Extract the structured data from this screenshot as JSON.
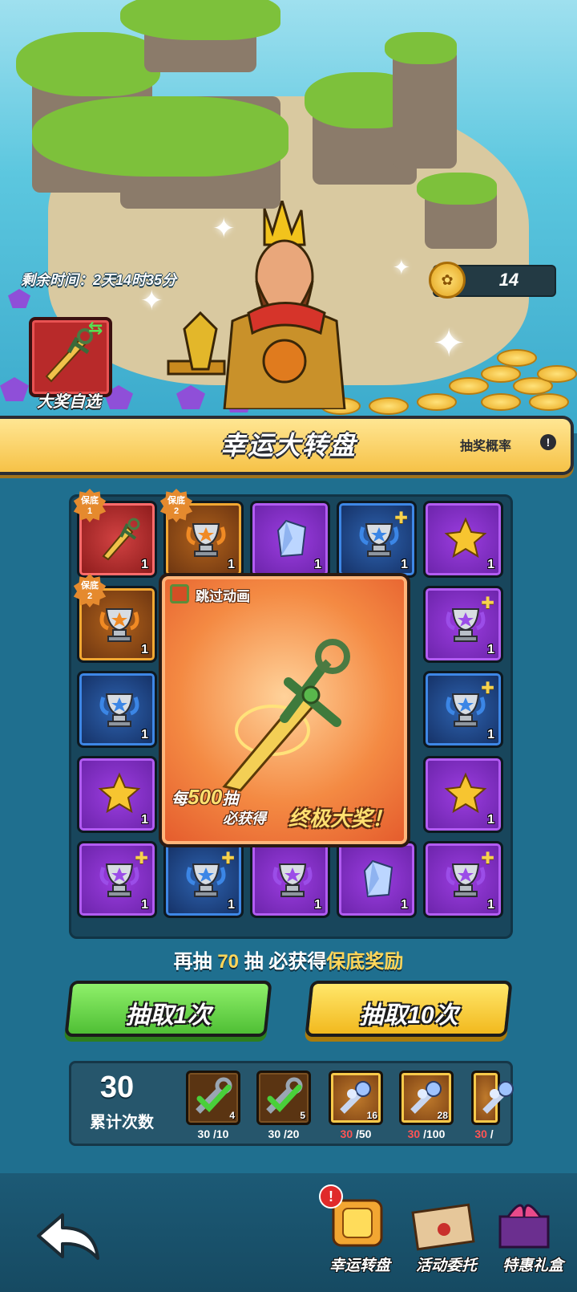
{
  "header": {
    "timer": "剩余时间：2天14时35分",
    "coins": "14",
    "grand_prize_label": "大奖自选"
  },
  "banner": {
    "title": "幸运大转盘",
    "prob_label": "抽奖概率",
    "prob_icon": "!"
  },
  "board": {
    "badge_label": "保底",
    "cells": [
      {
        "type": "sword",
        "color": "red",
        "qty": "1",
        "badge": "1"
      },
      {
        "type": "trophy-orange",
        "color": "orange",
        "qty": "1",
        "badge": "2"
      },
      {
        "type": "crystal",
        "color": "purple",
        "qty": "1"
      },
      {
        "type": "trophy-blue-plus",
        "color": "blue",
        "qty": "1"
      },
      {
        "type": "star",
        "color": "purple",
        "qty": "1"
      },
      {
        "type": "trophy-orange",
        "color": "orange",
        "qty": "1",
        "badge": "2"
      },
      {
        "type": "trophy-purple-plus",
        "color": "purple",
        "qty": "1"
      },
      {
        "type": "trophy-blue",
        "color": "blue",
        "qty": "1"
      },
      {
        "type": "trophy-blue-plus",
        "color": "blue",
        "qty": "1"
      },
      {
        "type": "star",
        "color": "purple",
        "qty": "1"
      },
      {
        "type": "star",
        "color": "purple",
        "qty": "1"
      },
      {
        "type": "trophy-purple-plus",
        "color": "purple",
        "qty": "1"
      },
      {
        "type": "trophy-blue-plus",
        "color": "blue",
        "qty": "1"
      },
      {
        "type": "trophy-purple",
        "color": "purple",
        "qty": "1"
      },
      {
        "type": "crystal",
        "color": "purple",
        "qty": "1"
      },
      {
        "type": "trophy-purple-plus",
        "color": "purple",
        "qty": "1"
      }
    ],
    "center": {
      "skip_label": "跳过动画",
      "every_prefix": "每",
      "every_num": "500",
      "every_suffix": "抽",
      "must_get": "必获得",
      "ultimate": "终极大奖！"
    }
  },
  "guarantee": {
    "prefix": "再抽",
    "num": "70",
    "mid": "抽 必获得",
    "reward": "保底奖励"
  },
  "buttons": {
    "draw1": "抽取1次",
    "draw10": "抽取10次"
  },
  "milestones": {
    "count": "30",
    "count_label": "累计次数",
    "items": [
      {
        "icon": "wrench-claimed",
        "qty": "4",
        "cur": "30",
        "target": "/10",
        "claimed": true
      },
      {
        "icon": "wrench-claimed",
        "qty": "5",
        "cur": "30",
        "target": "/20",
        "claimed": true
      },
      {
        "icon": "flower-wrench",
        "qty": "16",
        "cur": "30",
        "target": "/50",
        "claimed": false
      },
      {
        "icon": "flower-wrench",
        "qty": "28",
        "cur": "30",
        "target": "/100",
        "claimed": false
      },
      {
        "icon": "flower-wrench",
        "qty": "",
        "cur": "30",
        "target": "/",
        "claimed": false
      }
    ]
  },
  "nav": {
    "items": [
      {
        "label": "幸运转盘",
        "icon": "wheel-icon"
      },
      {
        "label": "活动委托",
        "icon": "letter-icon"
      },
      {
        "label": "特惠礼盒",
        "icon": "gift-icon"
      }
    ],
    "alert": "!"
  },
  "colors": {
    "accent_yellow": "#f6c247",
    "green_button": "#4fbf35",
    "yellow_button": "#f2b91e",
    "red_text": "#ff5454"
  }
}
